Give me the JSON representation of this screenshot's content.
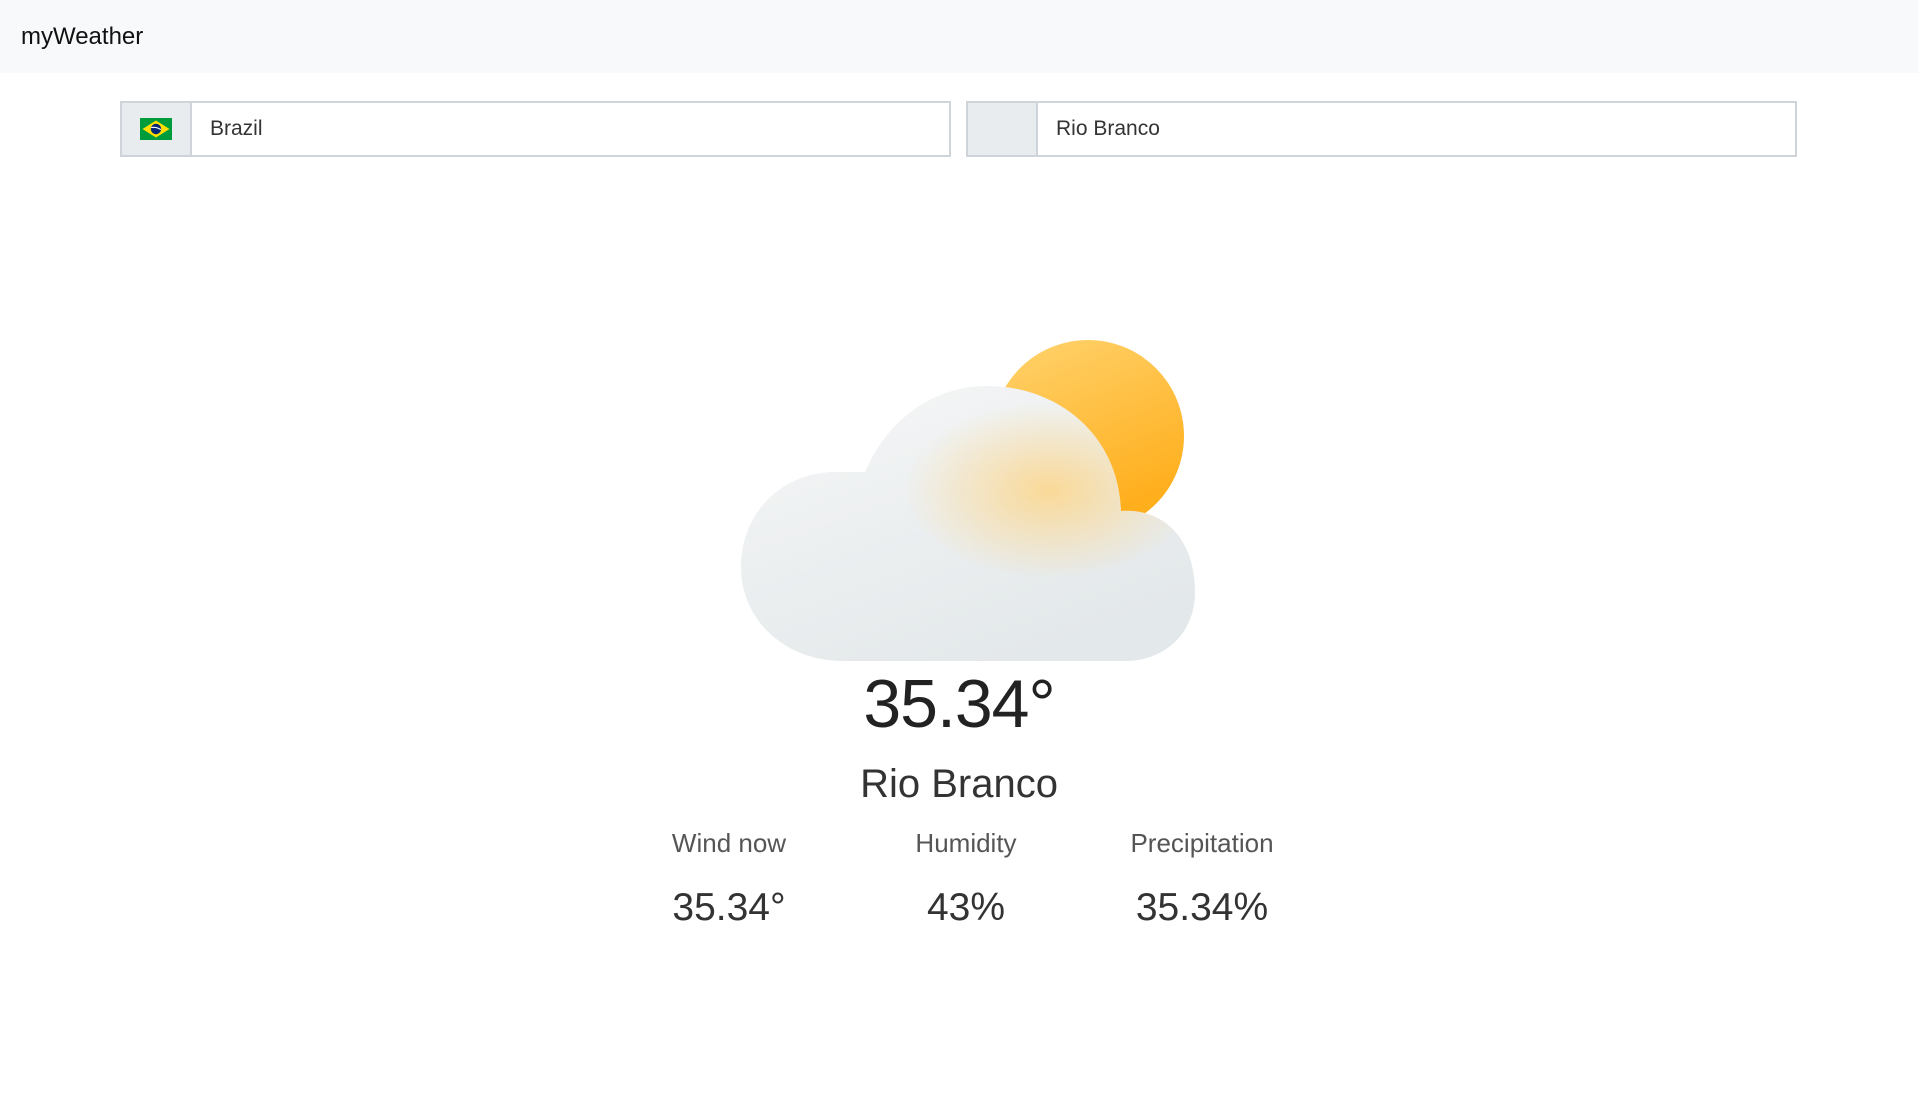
{
  "navbar": {
    "brand": "myWeather"
  },
  "selectors": {
    "country": {
      "flag_icon": "brazil-flag-icon",
      "value": "Brazil"
    },
    "city": {
      "value": "Rio Branco"
    }
  },
  "weather": {
    "condition_icon": "partly-cloudy-icon",
    "temperature": "35.34°",
    "city": "Rio Branco",
    "stats": [
      {
        "label": "Wind now",
        "value": "35.34°"
      },
      {
        "label": "Humidity",
        "value": "43%"
      },
      {
        "label": "Precipitation",
        "value": "35.34%"
      }
    ]
  },
  "colors": {
    "navbar_bg": "#f8f9fa",
    "border": "#ced4da",
    "addon_bg": "#e9ecef",
    "sun": "#ffb52e",
    "cloud": "#eef1f2",
    "flag_green": "#009c3b",
    "flag_yellow": "#ffdf00",
    "flag_blue": "#002776"
  }
}
